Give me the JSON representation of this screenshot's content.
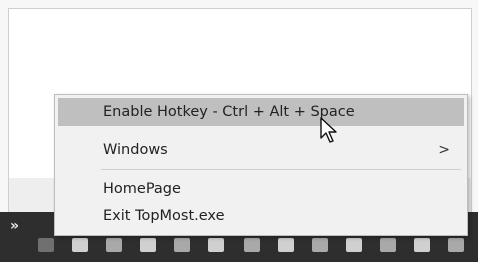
{
  "context_menu": {
    "items": [
      {
        "label": "Enable Hotkey - Ctrl + Alt + Space",
        "highlighted": true
      },
      {
        "label": "Windows",
        "submenu_arrow": ">"
      },
      {
        "label": "HomePage"
      },
      {
        "label": "Exit TopMost.exe"
      }
    ]
  },
  "taskbar": {
    "overflow_chevron": "»"
  },
  "colors": {
    "menu_background": "#f1f1f1",
    "highlight": "#bfbfbf",
    "taskbar": "#2e2e2e"
  },
  "icons": [
    "mouse-cursor-icon",
    "tray-icons"
  ]
}
